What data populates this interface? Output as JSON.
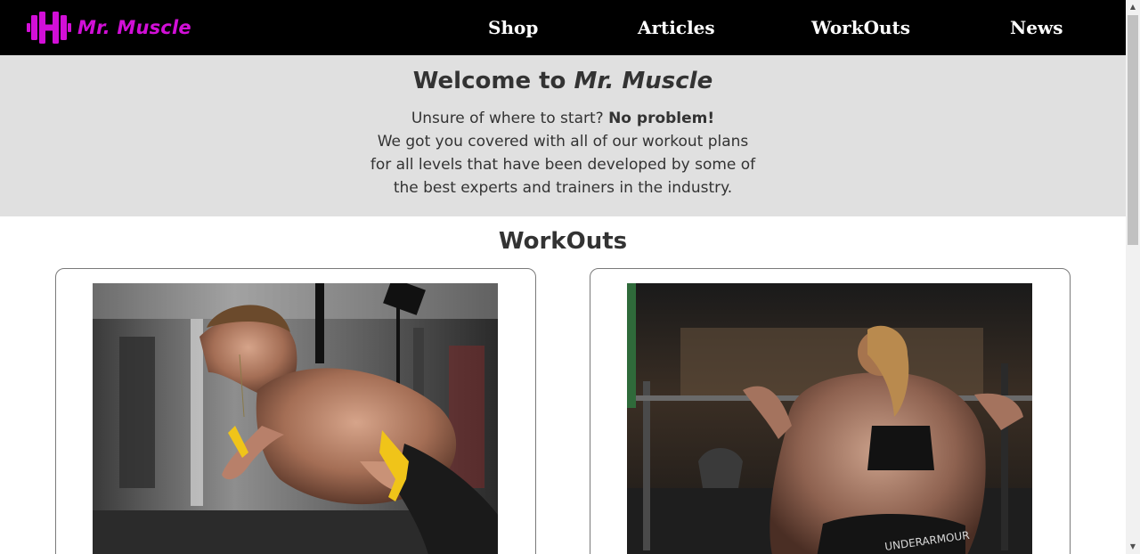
{
  "nav": {
    "brand": "Mr. Muscle",
    "brand_icon": "dumbbell-icon",
    "brand_color": "#d20fd7",
    "links": [
      "Shop",
      "Articles",
      "WorkOuts",
      "News"
    ]
  },
  "hero": {
    "title_prefix": "Welcome to ",
    "title_brand": "Mr. Muscle",
    "line1_prefix": "Unsure of where to start? ",
    "line1_bold": "No problem!",
    "line2": "We got you covered with all of our workout plans",
    "line3": "for all levels that have been developed by some of",
    "line4": "the best experts and trainers in the industry.",
    "background": "#e0e0e0"
  },
  "workouts": {
    "title": "WorkOuts",
    "cards": [
      {
        "image": "man-suspension-trainer-photo"
      },
      {
        "image": "woman-barbell-squat-photo"
      }
    ]
  },
  "scrollbar": {
    "up_icon": "scroll-up-arrow-icon",
    "down_icon": "scroll-down-arrow-icon"
  }
}
